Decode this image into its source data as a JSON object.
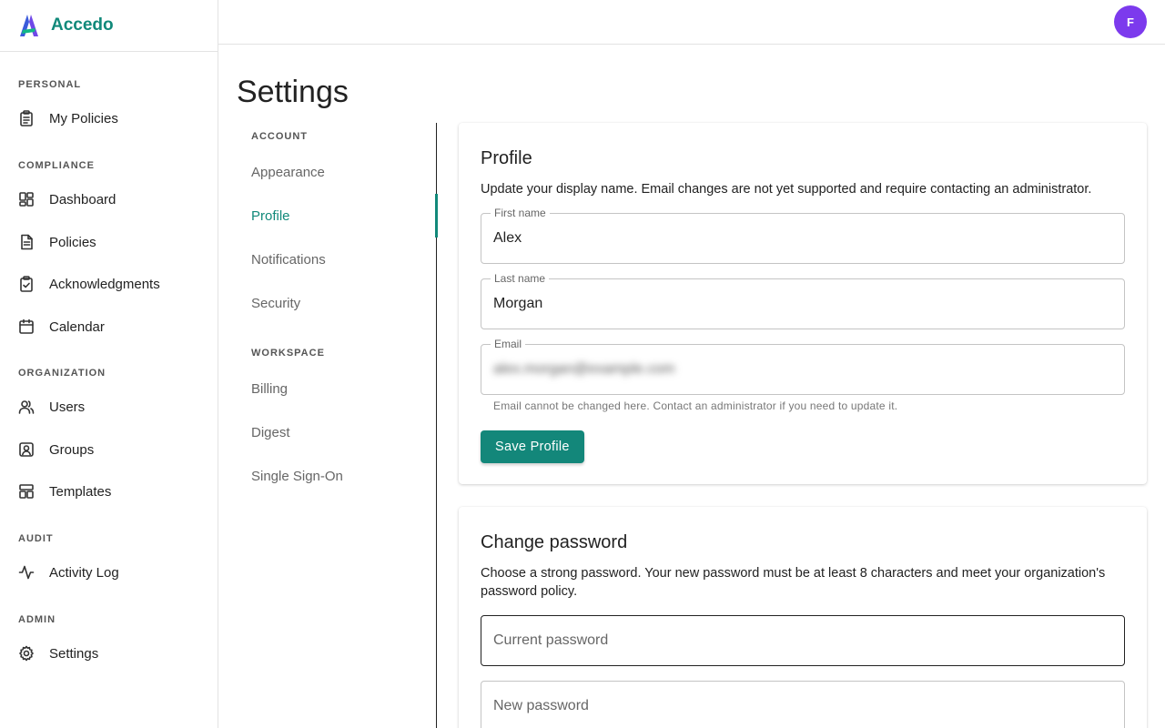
{
  "brand": {
    "name": "Accedo"
  },
  "user": {
    "avatar_initial": "F",
    "avatar_color": "#7c3aed"
  },
  "colors": {
    "accent": "#11897a",
    "button": "#13877a"
  },
  "sidebar": {
    "sections": [
      {
        "label": "PERSONAL",
        "items": [
          {
            "label": "My Policies",
            "icon": "clipboard-icon"
          }
        ]
      },
      {
        "label": "COMPLIANCE",
        "items": [
          {
            "label": "Dashboard",
            "icon": "dashboard-icon"
          },
          {
            "label": "Policies",
            "icon": "document-icon"
          },
          {
            "label": "Acknowledgments",
            "icon": "clipboard-check-icon"
          },
          {
            "label": "Calendar",
            "icon": "calendar-icon"
          }
        ]
      },
      {
        "label": "ORGANIZATION",
        "items": [
          {
            "label": "Users",
            "icon": "users-icon"
          },
          {
            "label": "Groups",
            "icon": "group-icon"
          },
          {
            "label": "Templates",
            "icon": "template-icon"
          }
        ]
      },
      {
        "label": "AUDIT",
        "items": [
          {
            "label": "Activity Log",
            "icon": "activity-icon"
          }
        ]
      },
      {
        "label": "ADMIN",
        "items": [
          {
            "label": "Settings",
            "icon": "gear-icon"
          }
        ]
      }
    ]
  },
  "page": {
    "title": "Settings"
  },
  "settings_nav": {
    "sections": [
      {
        "label": "ACCOUNT",
        "items": [
          "Appearance",
          "Profile",
          "Notifications",
          "Security"
        ]
      },
      {
        "label": "WORKSPACE",
        "items": [
          "Billing",
          "Digest",
          "Single Sign-On"
        ]
      }
    ],
    "active": "Profile"
  },
  "profile": {
    "title": "Profile",
    "description": "Update your display name. Email changes are not yet supported and require contacting an administrator.",
    "first_name_label": "First name",
    "first_name_value": "Alex",
    "last_name_label": "Last name",
    "last_name_value": "Morgan",
    "email_label": "Email",
    "email_value": "alex.morgan@example.com",
    "email_helper": "Email cannot be changed here. Contact an administrator if you need to update it.",
    "save_label": "Save Profile"
  },
  "password": {
    "title": "Change password",
    "description": "Choose a strong password. Your new password must be at least 8 characters and meet your organization's password policy.",
    "current_placeholder": "Current password",
    "new_placeholder": "New password"
  }
}
